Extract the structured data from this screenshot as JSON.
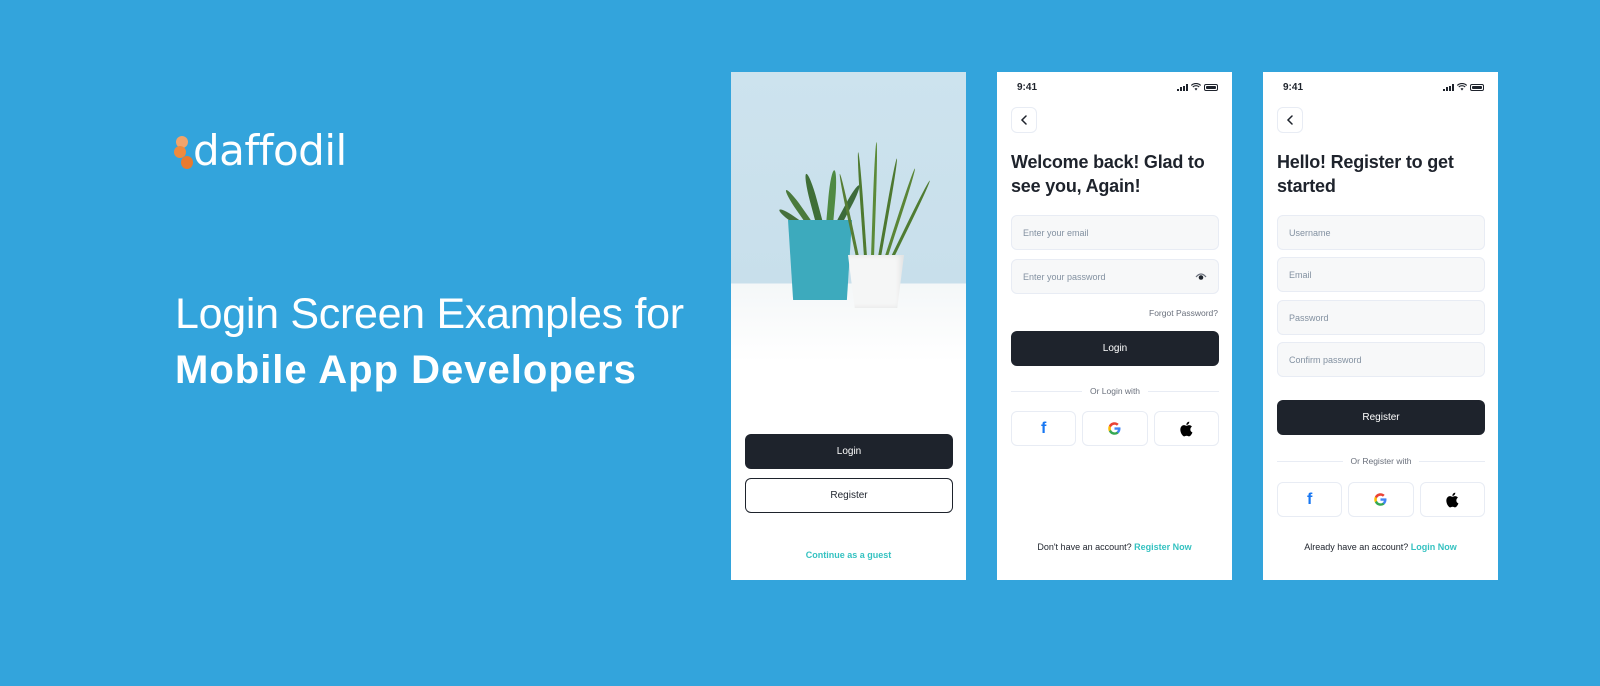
{
  "brand": {
    "name": "daffodil",
    "accent": "#ef8a3d",
    "background": "#33a4dc"
  },
  "headline": {
    "line1": "Login Screen Examples for",
    "line2": "Mobile App Developers"
  },
  "colors": {
    "dark": "#1e232c",
    "teal": "#35c2c1",
    "field_bg": "#f7f8f9",
    "placeholder": "#8391a1"
  },
  "screens": {
    "welcome": {
      "login_label": "Login",
      "register_label": "Register",
      "guest_label": "Continue as a guest"
    },
    "login": {
      "status_time": "9:41",
      "title": "Welcome back! Glad to see you, Again!",
      "email_placeholder": "Enter your email",
      "password_placeholder": "Enter your password",
      "forgot_label": "Forgot Password?",
      "login_label": "Login",
      "divider_label": "Or Login with",
      "social": [
        "facebook",
        "google",
        "apple"
      ],
      "footer_text": "Don't have an account?",
      "footer_link": "Register Now"
    },
    "register": {
      "status_time": "9:41",
      "title": "Hello! Register to get started",
      "username_placeholder": "Username",
      "email_placeholder": "Email",
      "password_placeholder": "Password",
      "confirm_placeholder": "Confirm password",
      "register_label": "Register",
      "divider_label": "Or Register with",
      "social": [
        "facebook",
        "google",
        "apple"
      ],
      "footer_text": "Already have an account?",
      "footer_link": "Login Now"
    }
  }
}
